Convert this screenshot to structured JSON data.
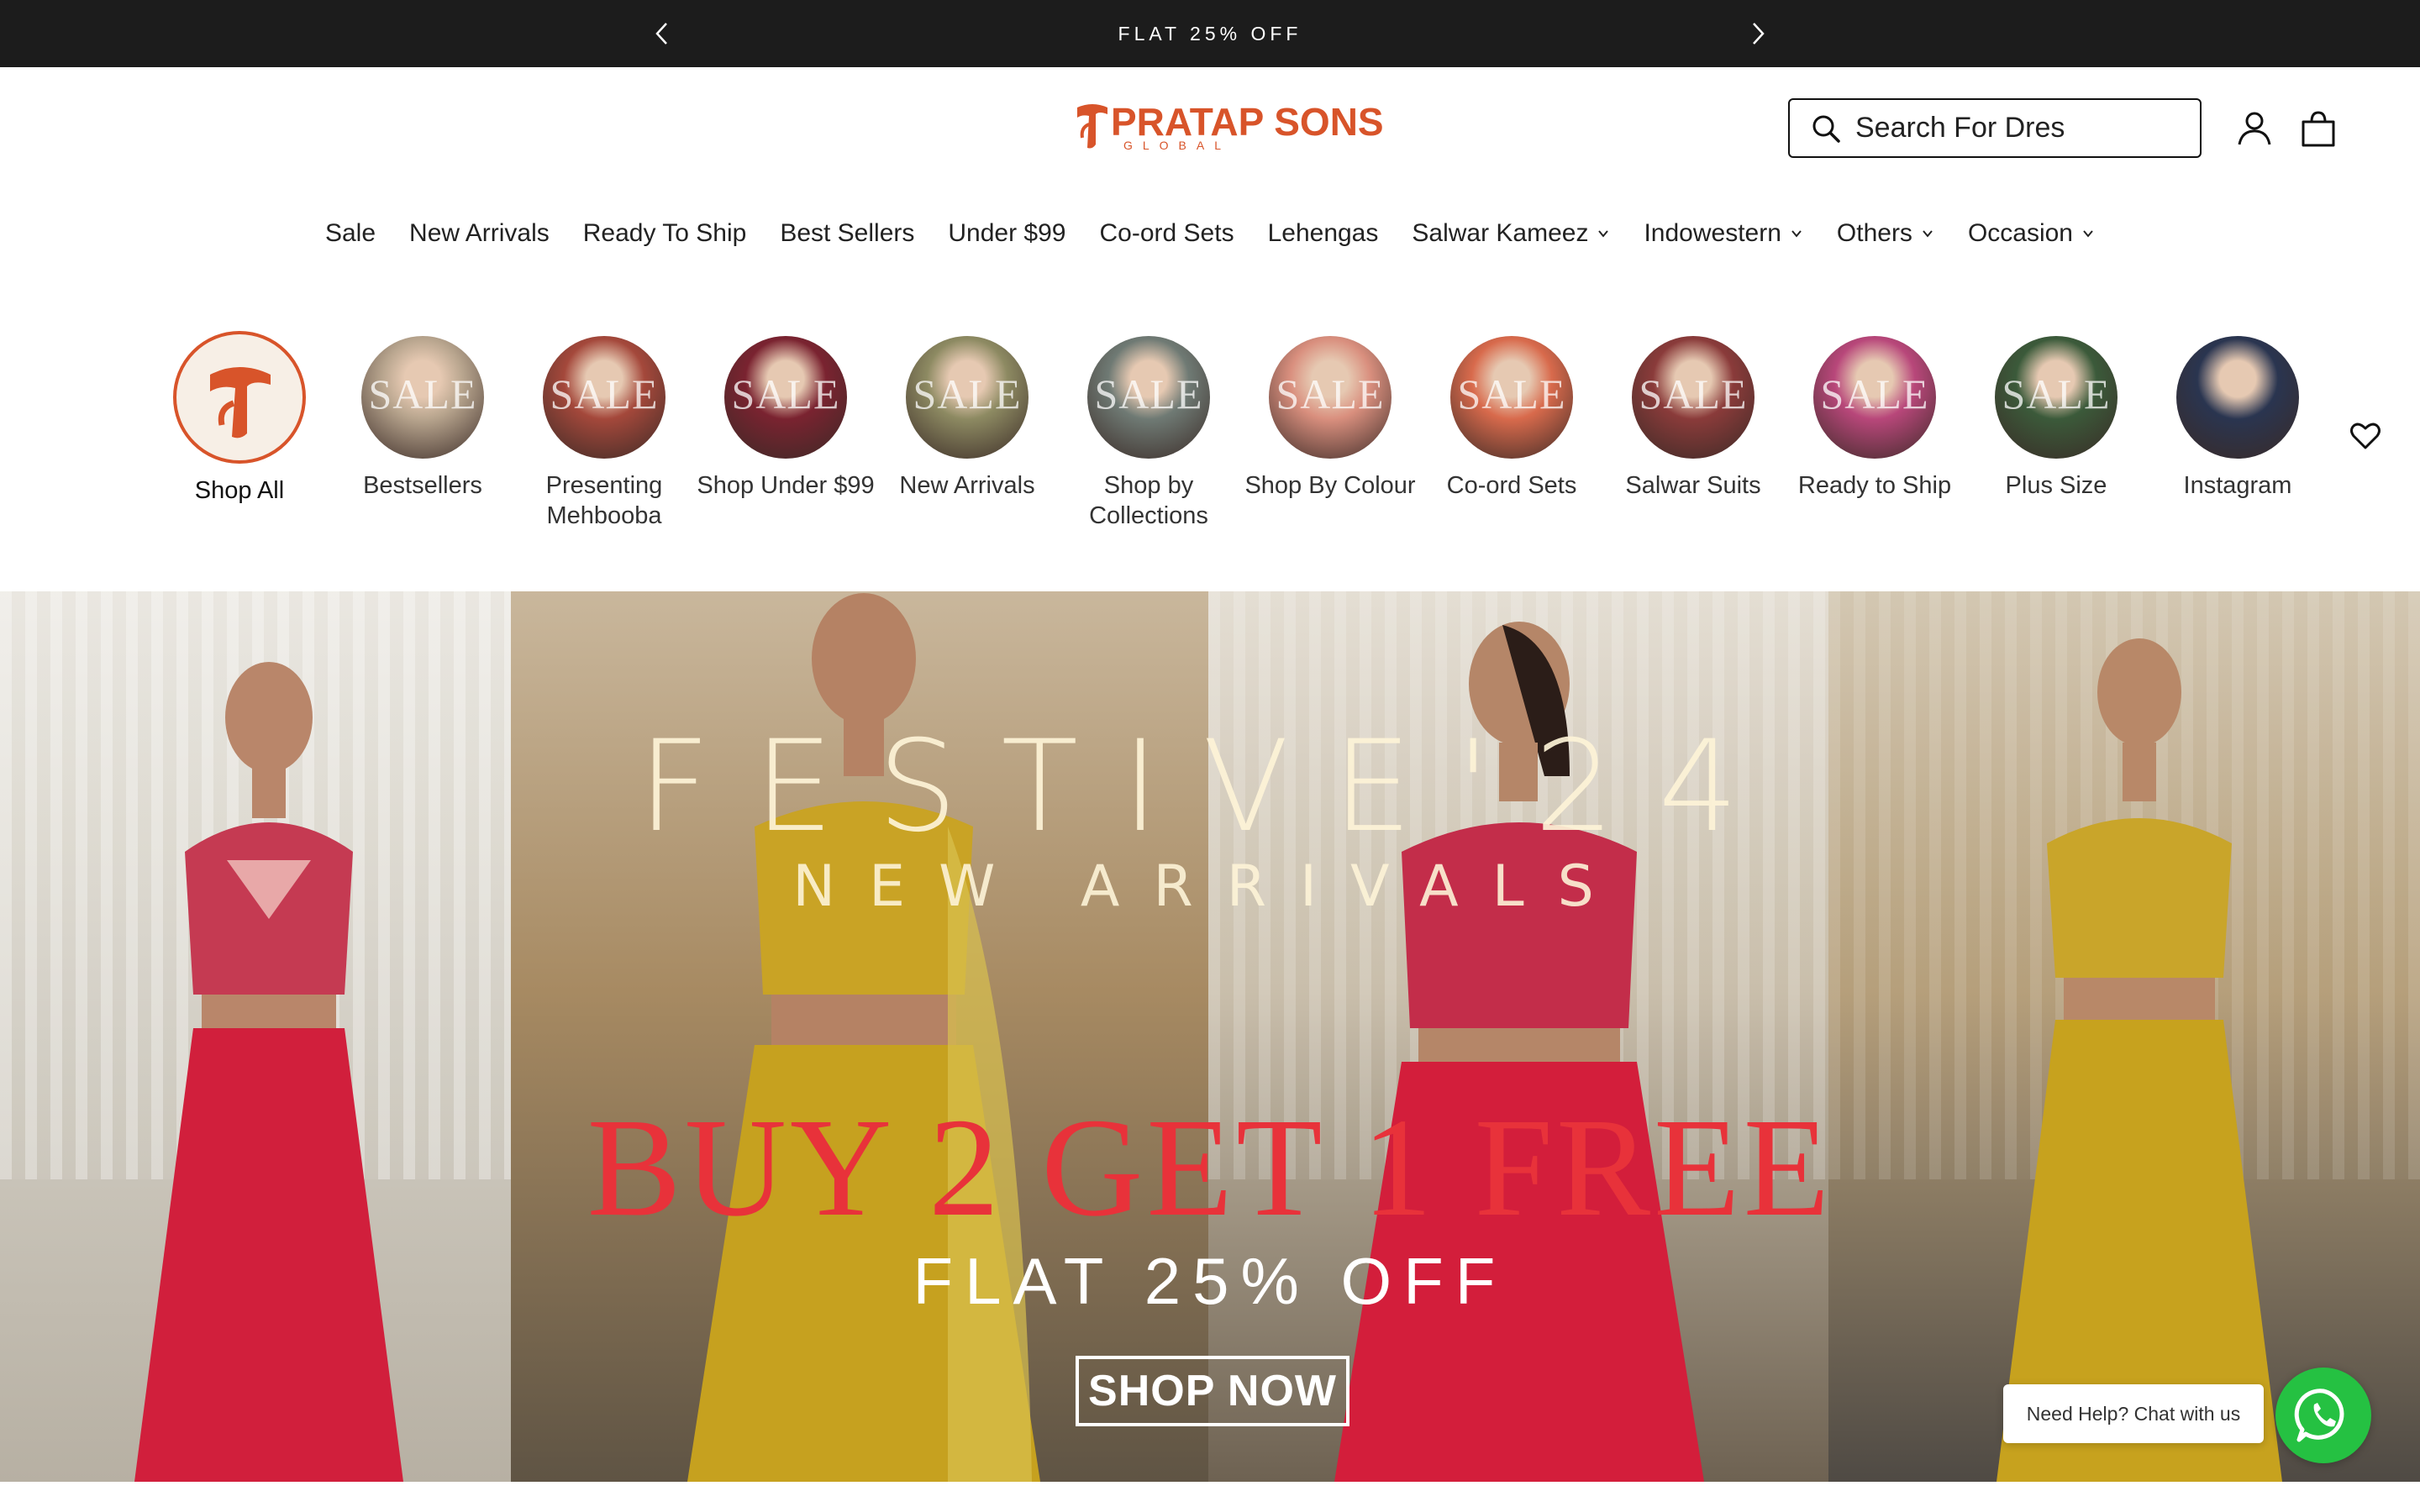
{
  "announcement": {
    "text": "FLAT 25% OFF",
    "prev_icon": "chevron-left-icon",
    "next_icon": "chevron-right-icon"
  },
  "header": {
    "logo_text": "PRATAP SONS",
    "logo_subtext": "GLOBAL",
    "brand_color": "#d8542a",
    "search": {
      "value": "Search For Dres",
      "icon": "search-icon"
    },
    "icons": [
      "account-icon",
      "cart-icon"
    ]
  },
  "nav": [
    {
      "label": "Sale",
      "dropdown": false
    },
    {
      "label": "New Arrivals",
      "dropdown": false
    },
    {
      "label": "Ready To Ship",
      "dropdown": false
    },
    {
      "label": "Best Sellers",
      "dropdown": false
    },
    {
      "label": "Under $99",
      "dropdown": false
    },
    {
      "label": "Co-ord Sets",
      "dropdown": false
    },
    {
      "label": "Lehengas",
      "dropdown": false
    },
    {
      "label": "Salwar Kameez",
      "dropdown": true
    },
    {
      "label": "Indowestern",
      "dropdown": true
    },
    {
      "label": "Others",
      "dropdown": true
    },
    {
      "label": "Occasion",
      "dropdown": true
    }
  ],
  "categories": [
    {
      "label": "Shop All",
      "overlay": "",
      "color": "#f7efe6"
    },
    {
      "label": "Bestsellers",
      "overlay": "SALE",
      "color": "#b8a58e"
    },
    {
      "label": "Presenting Mehbooba",
      "overlay": "SALE",
      "color": "#a4483b"
    },
    {
      "label": "Shop Under $99",
      "overlay": "SALE",
      "color": "#7a2330"
    },
    {
      "label": "New Arrivals",
      "overlay": "SALE",
      "color": "#8d8a62"
    },
    {
      "label": "Shop by Collections",
      "overlay": "SALE",
      "color": "#6f7a74"
    },
    {
      "label": "Shop By Colour",
      "overlay": "SALE",
      "color": "#d98f7e"
    },
    {
      "label": "Co-ord Sets",
      "overlay": "SALE",
      "color": "#d86a4c"
    },
    {
      "label": "Salwar Suits",
      "overlay": "SALE",
      "color": "#8a3b3a"
    },
    {
      "label": "Ready to Ship",
      "overlay": "SALE",
      "color": "#b8477a"
    },
    {
      "label": "Plus Size",
      "overlay": "SALE",
      "color": "#3b5a3a"
    },
    {
      "label": "Instagram",
      "overlay": "",
      "color": "#2a3550"
    }
  ],
  "wishlist_icon": "heart-icon",
  "hero": {
    "line1": "FESTIVE'24",
    "line2": "NEW ARRIVALS",
    "line3": "BUY 2 GET 1 FREE",
    "line4": "FLAT 25% OFF",
    "cta": "SHOP NOW",
    "accent": "#e8323a"
  },
  "chat": {
    "bubble": "Need Help? Chat with us",
    "icon": "whatsapp-icon",
    "color": "#25c142"
  }
}
